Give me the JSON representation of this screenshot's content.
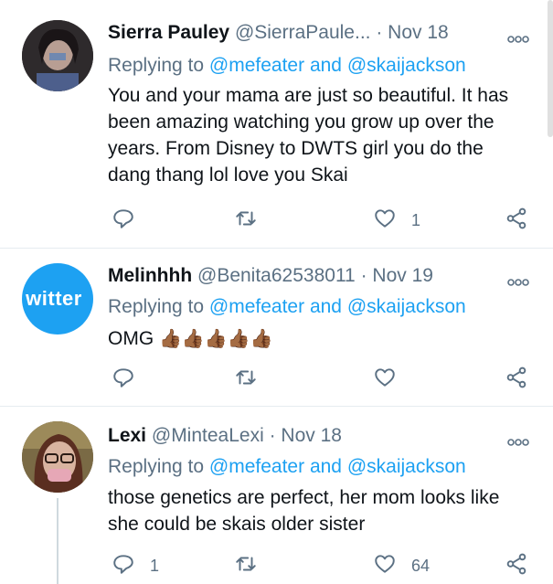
{
  "tweets": [
    {
      "name": "Sierra Pauley",
      "handle": "@SierraPaule...",
      "date": "· Nov 18",
      "reply_prefix": "Replying to",
      "mention1": "@mefeater",
      "and": "and",
      "mention2": "@skaijackson",
      "body": "You and your mama are just so beautiful. It has been amazing watching you grow up over the years. From Disney to DWTS girl you do the dang thang lol love you Skai",
      "reply_count": "",
      "retweet_count": "",
      "like_count": "1"
    },
    {
      "name": "Melinhhh",
      "handle": "@Benita62538011",
      "date": "· Nov 19",
      "avatar_text": "witter",
      "reply_prefix": "Replying to",
      "mention1": "@mefeater",
      "and": "and",
      "mention2": "@skaijackson",
      "body": "OMG",
      "emoji": "👍🏾👍🏾👍🏾👍🏾👍🏾",
      "reply_count": "",
      "retweet_count": "",
      "like_count": ""
    },
    {
      "name": "Lexi",
      "handle": "@MinteaLexi",
      "date": "· Nov 18",
      "reply_prefix": "Replying to",
      "mention1": "@mefeater",
      "and": "and",
      "mention2": "@skaijackson",
      "body": "those genetics are perfect, her mom looks like she could be skais older sister",
      "reply_count": "1",
      "retweet_count": "",
      "like_count": "64"
    }
  ],
  "icons": [
    "more-icon",
    "reply-icon",
    "retweet-icon",
    "like-icon",
    "share-icon"
  ],
  "colors": {
    "mention": "#1da1f2",
    "muted": "#5b7083",
    "avatar2_bg": "#1da1f2"
  }
}
